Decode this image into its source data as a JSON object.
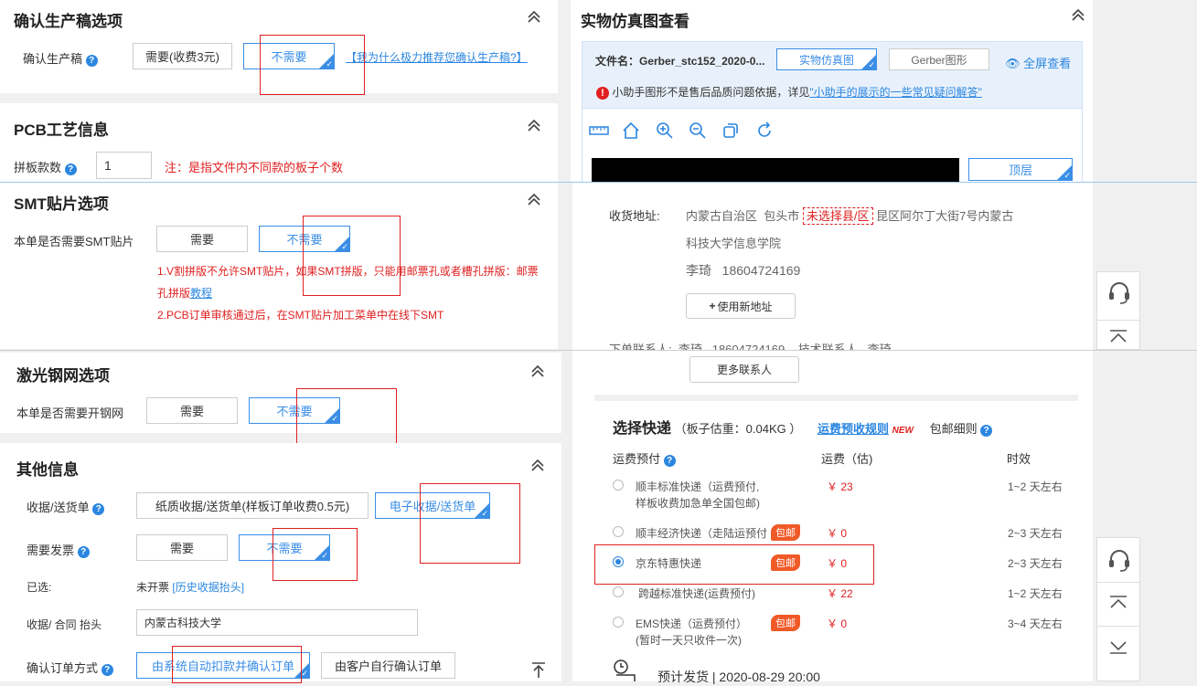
{
  "confirm": {
    "title": "确认生产稿选项",
    "label": "确认生产稿",
    "opt_need": "需要(收费3元)",
    "opt_noneed": "不需要",
    "why_link": "【我为什么极力推荐您确认生产稿?】"
  },
  "pcb": {
    "title": "PCB工艺信息",
    "label": "拼板款数",
    "value": "1",
    "note": "注：是指文件内不同款的板子个数"
  },
  "smt": {
    "title": "SMT贴片选项",
    "label": "本单是否需要SMT贴片",
    "opt_need": "需要",
    "opt_noneed": "不需要",
    "note1": "1.V割拼版不允许SMT贴片，如果SMT拼版，只能用邮票孔或者槽孔拼版：邮票",
    "note1b": "孔拼版",
    "note1_link": "教程",
    "note2": "2.PCB订单审核通过后，在SMT贴片加工菜单中在线下SMT"
  },
  "stencil": {
    "title": "激光钢网选项",
    "label": "本单是否需要开钢网",
    "opt_need": "需要",
    "opt_noneed": "不需要"
  },
  "other": {
    "title": "其他信息",
    "receipt_label": "收据/送货单",
    "receipt_paper": "纸质收据/送货单(样板订单收费0.5元)",
    "receipt_electronic": "电子收据/送货单",
    "invoice_label": "需要发票",
    "invoice_need": "需要",
    "invoice_noneed": "不需要",
    "selected_label": "已选:",
    "selected_value": "未开票",
    "history_link": "[历史收据抬头]",
    "header_label": "收据/ 合同 抬头",
    "header_value": "内蒙古科技大学",
    "confirm_label": "确认订单方式",
    "confirm_auto": "由系统自动扣款并确认订单",
    "confirm_manual": "由客户自行确认订单"
  },
  "sim": {
    "title": "实物仿真图查看",
    "file_label": "文件名：Gerber_stc152_2020-0...",
    "btn_sim": "实物仿真图",
    "btn_gerber": "Gerber图形",
    "fullscreen": "全屏查看",
    "warn_text": "小助手图形不是售后品质问题依据，详见",
    "warn_link": "\"小助手的展示的一些常见疑问解答\"",
    "layer": "顶层",
    "tool_icons": [
      "ruler-icon",
      "home-icon",
      "zoom-in-icon",
      "zoom-out-icon",
      "copy-icon",
      "refresh-icon"
    ]
  },
  "address": {
    "label": "收货地址:",
    "province": "内蒙古自治区",
    "city": "包头市",
    "district": "未选择县/区",
    "street": "昆区阿尔丁大街7号内蒙古",
    "street2": "科技大学信息学院",
    "name": "李琦",
    "phone": "18604724169",
    "new_addr": "使用新地址",
    "contact_label": "下单联系人:",
    "contact_name": "李琦",
    "contact_phone": "18604724169",
    "tech_label": "技术联系人",
    "tech_name": "李琦",
    "more_contacts": "更多联系人"
  },
  "shipping": {
    "title": "选择快递",
    "weight": "（板子估重：0.04KG ）",
    "rule_link": "运费预收规则",
    "new_tag": "NEW",
    "detail": "包邮细则",
    "col_prepay": "运费预付",
    "col_fee": "运费（估)",
    "col_time": "时效",
    "options": [
      {
        "name": "顺丰标准快递（运费预付,",
        "name2": "样板收费加急单全国包邮)",
        "fee": "￥ 23",
        "time": "1~2 天左右",
        "badge": "",
        "selected": false
      },
      {
        "name": "顺丰经济快递（走陆运预付",
        "name2": "",
        "fee": "￥ 0",
        "time": "2~3 天左右",
        "badge": "包邮",
        "selected": false
      },
      {
        "name": "京东特惠快递",
        "name2": "",
        "fee": "￥ 0",
        "time": "2~3 天左右",
        "badge": "包邮",
        "selected": true
      },
      {
        "name": "跨越标准快递(运费预付)",
        "name2": "",
        "fee": "￥ 22",
        "time": "1~2 天左右",
        "badge": "",
        "selected": false
      },
      {
        "name": "EMS快递（运费预付）",
        "name2": "(暂时一天只收件一次)",
        "fee": "￥ 0",
        "time": "3~4 天左右",
        "badge": "包邮",
        "selected": false
      }
    ],
    "ship_date": "预计发货 | 2020-08-29 20:00"
  },
  "colors": {
    "accent": "#2b86e0",
    "red": "#e02020",
    "badge": "#f05a28"
  }
}
